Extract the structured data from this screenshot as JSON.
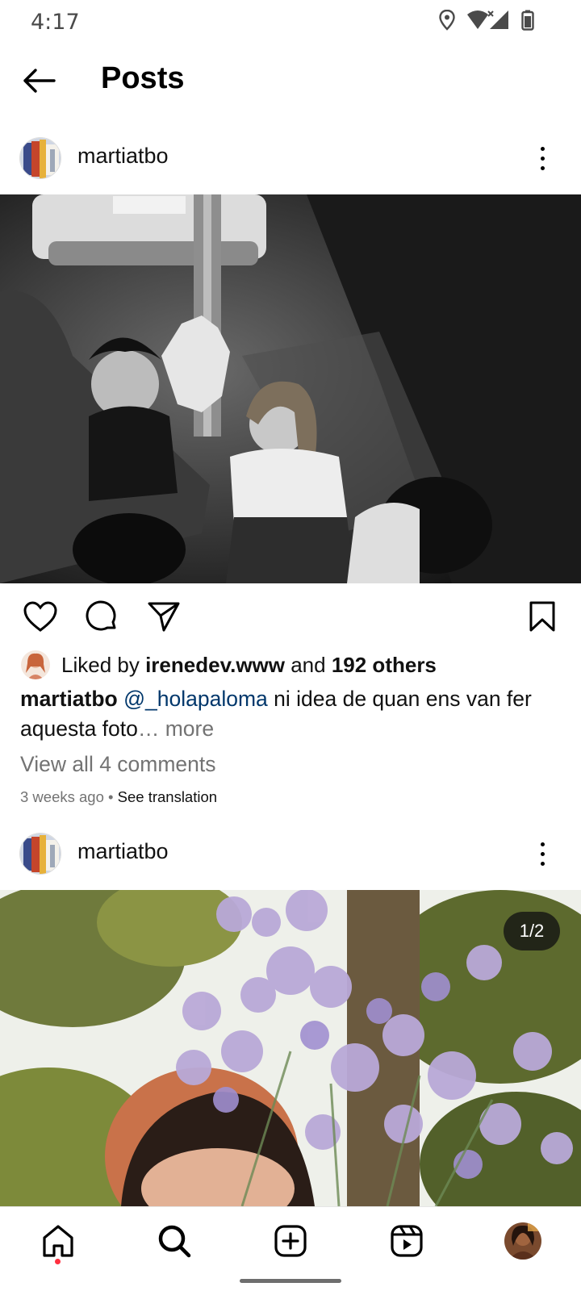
{
  "status_bar": {
    "time": "4:17"
  },
  "header": {
    "title": "Posts"
  },
  "posts": [
    {
      "username": "martiatbo",
      "liked_by_prefix": "Liked by ",
      "liked_by_user": "irenedev.www",
      "liked_by_middle": " and ",
      "liked_by_others": "192 others",
      "caption_user": "martiatbo",
      "caption_mention": "@_holapaloma",
      "caption_text": " ni idea de quan ens van fer aquesta foto",
      "caption_more": "… more",
      "view_comments": "View all 4 comments",
      "time_ago": "3 weeks ago",
      "meta_separator": " • ",
      "see_translation": "See translation"
    },
    {
      "username": "martiatbo",
      "carousel_indicator": "1/2"
    }
  ],
  "icons": {
    "back": "arrow-left-icon",
    "more": "more-vertical-icon",
    "like": "heart-icon",
    "comment": "comment-bubble-icon",
    "share": "send-icon",
    "save": "bookmark-icon",
    "home": "home-icon",
    "search": "search-icon",
    "create": "plus-square-icon",
    "reels": "reels-icon",
    "profile": "profile-avatar"
  },
  "colors": {
    "mention": "#00376b",
    "muted": "#737373",
    "notification": "#ff3040"
  }
}
